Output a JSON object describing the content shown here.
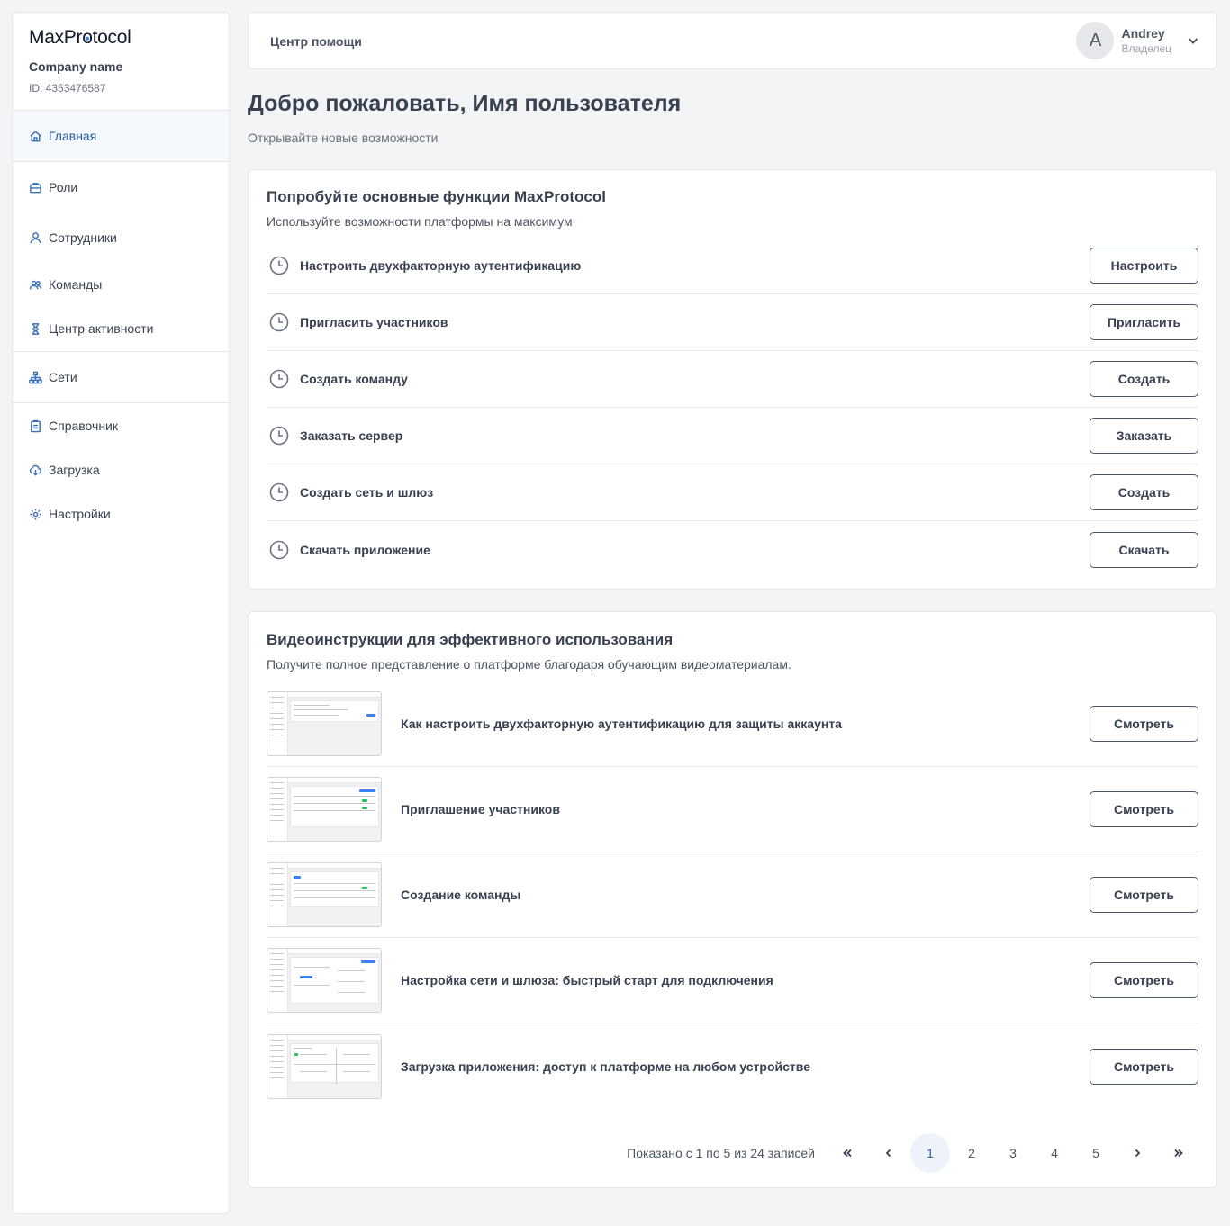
{
  "brand": {
    "logo": "MaxProtocol",
    "company_name": "Company name",
    "company_id": "ID: 4353476587"
  },
  "nav": [
    {
      "label": "Главная",
      "icon": "home-icon",
      "active": true
    },
    {
      "label": "Роли",
      "icon": "briefcase-icon"
    },
    {
      "label": "Сотрудники",
      "icon": "user-icon"
    },
    {
      "label": "Команды",
      "icon": "users-icon"
    },
    {
      "label": "Центр активности",
      "icon": "hourglass-icon"
    },
    {
      "label": "Сети",
      "icon": "network-icon"
    },
    {
      "label": "Справочник",
      "icon": "clipboard-icon"
    },
    {
      "label": "Загрузка",
      "icon": "cloud-download-icon"
    },
    {
      "label": "Настройки",
      "icon": "gear-icon"
    }
  ],
  "header": {
    "help_link": "Центр помощи",
    "user": {
      "initial": "A",
      "name": "Andrey",
      "role": "Владелец"
    }
  },
  "page": {
    "title": "Добро пожаловать, Имя пользователя",
    "subtitle": "Открывайте новые возможности"
  },
  "features": {
    "title": "Попробуйте основные функции MaxProtocol",
    "subtitle": "Используйте возможности платформы на максимум",
    "items": [
      {
        "label": "Настроить двухфакторную аутентификацию",
        "button": "Настроить"
      },
      {
        "label": "Пригласить участников",
        "button": "Пригласить"
      },
      {
        "label": "Создать команду",
        "button": "Создать"
      },
      {
        "label": "Заказать сервер",
        "button": "Заказать"
      },
      {
        "label": "Создать сеть и шлюз",
        "button": "Создать"
      },
      {
        "label": "Скачать приложение",
        "button": "Скачать"
      }
    ]
  },
  "videos": {
    "title": "Видеоинструкции для эффективного использования",
    "subtitle": "Получите полное представление о платформе благодаря обучающим видеоматериалам.",
    "items": [
      {
        "label": "Как настроить двухфакторную аутентификацию для защиты аккаунта",
        "button": "Смотреть"
      },
      {
        "label": "Приглашение участников",
        "button": "Смотреть"
      },
      {
        "label": "Создание команды",
        "button": "Смотреть"
      },
      {
        "label": "Настройка сети и шлюза: быстрый старт для подключения",
        "button": "Смотреть"
      },
      {
        "label": "Загрузка приложения: доступ к платформе на любом устройстве",
        "button": "Смотреть"
      }
    ],
    "pagination": {
      "info": "Показано с 1 по 5 из 24 записей",
      "pages": [
        "1",
        "2",
        "3",
        "4",
        "5"
      ],
      "current": "1"
    }
  },
  "colors": {
    "accent": "#2b5aa0",
    "icon": "#3b6fb6",
    "background": "#f3f4f6"
  }
}
